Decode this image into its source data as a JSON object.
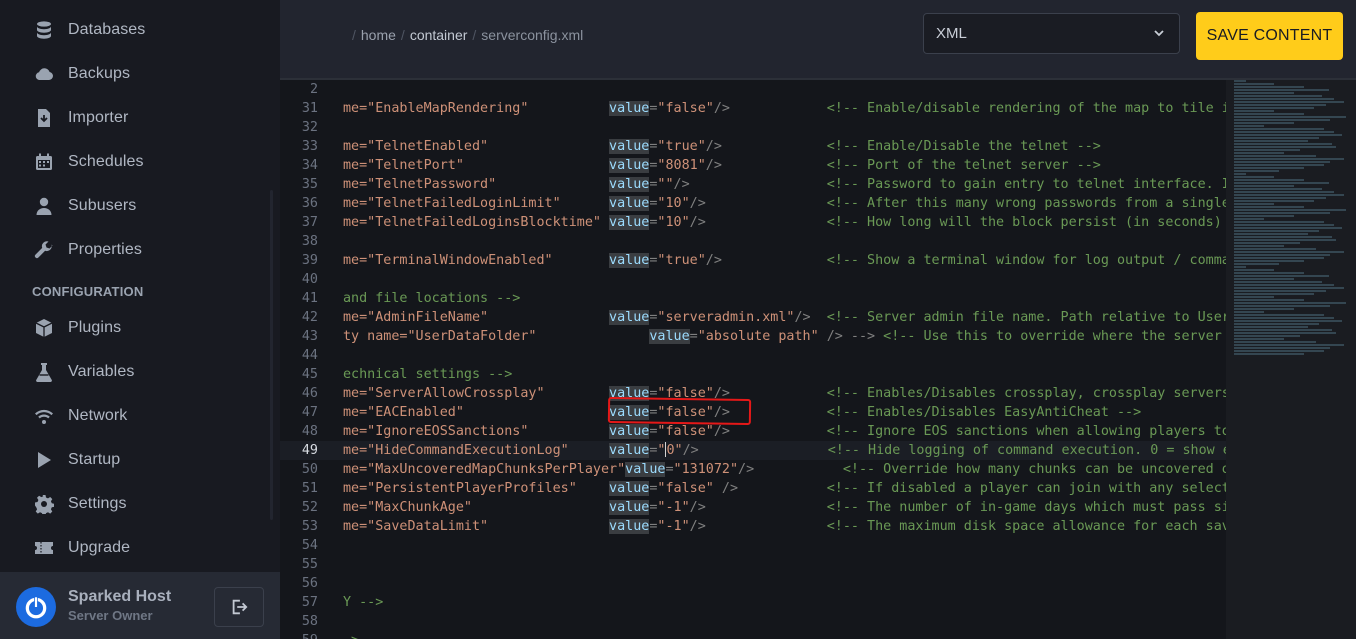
{
  "sidebar": {
    "items": [
      {
        "label": "Databases",
        "icon": "database-icon"
      },
      {
        "label": "Backups",
        "icon": "cloud-icon"
      },
      {
        "label": "Importer",
        "icon": "import-file-icon"
      },
      {
        "label": "Schedules",
        "icon": "calendar-icon"
      },
      {
        "label": "Subusers",
        "icon": "user-icon"
      },
      {
        "label": "Properties",
        "icon": "wrench-icon"
      }
    ],
    "section_configuration": "CONFIGURATION",
    "config_items": [
      {
        "label": "Plugins",
        "icon": "cube-icon"
      },
      {
        "label": "Variables",
        "icon": "flask-icon"
      },
      {
        "label": "Network",
        "icon": "wifi-icon"
      },
      {
        "label": "Startup",
        "icon": "play-icon"
      },
      {
        "label": "Settings",
        "icon": "gear-icon"
      },
      {
        "label": "Upgrade",
        "icon": "ticket-icon"
      }
    ],
    "user": {
      "name": "Sparked Host",
      "role": "Server Owner"
    }
  },
  "header": {
    "breadcrumb": [
      "home",
      "container",
      "serverconfig.xml"
    ],
    "select_value": "XML",
    "save_label": "SAVE CONTENT"
  },
  "editor": {
    "lines": [
      {
        "n": "2",
        "name": "",
        "val": "",
        "comment": "",
        "plain": ""
      },
      {
        "n": "31",
        "name": "me=\"EnableMapRendering\"",
        "val": "\"false\"",
        "close": "/>",
        "comment": "<!-- Enable/disable rendering of the map to tile im"
      },
      {
        "n": "32",
        "plain": ""
      },
      {
        "n": "33",
        "name": "me=\"TelnetEnabled\"",
        "val": "\"true\"",
        "close": "/>",
        "comment": "<!-- Enable/Disable the telnet -->"
      },
      {
        "n": "34",
        "name": "me=\"TelnetPort\"",
        "val": "\"8081\"",
        "close": "/>",
        "comment": "<!-- Port of the telnet server -->"
      },
      {
        "n": "35",
        "name": "me=\"TelnetPassword\"",
        "val": "\"\"",
        "close": "/>",
        "comment": "<!-- Password to gain entry to telnet interface. If"
      },
      {
        "n": "36",
        "name": "me=\"TelnetFailedLoginLimit\"",
        "val": "\"10\"",
        "close": "/>",
        "comment": "<!-- After this many wrong passwords from a single"
      },
      {
        "n": "37",
        "name": "me=\"TelnetFailedLoginsBlocktime\"",
        "val": "\"10\"",
        "close": "/>",
        "comment": "<!-- How long will the block persist (in seconds) -"
      },
      {
        "n": "38",
        "plain": ""
      },
      {
        "n": "39",
        "name": "me=\"TerminalWindowEnabled\"",
        "val": "\"true\"",
        "close": "/>",
        "comment": "<!-- Show a terminal window for log output / comman"
      },
      {
        "n": "40",
        "plain": ""
      },
      {
        "n": "41",
        "plain": "and file locations -->"
      },
      {
        "n": "42",
        "name": "me=\"AdminFileName\"",
        "val": "\"serveradmin.xml\"",
        "close": "/>",
        "comment": "<!-- Server admin file name. Path relative to UserD"
      },
      {
        "n": "43",
        "special": true,
        "name": "ty name=\"UserDataFolder\"",
        "val": "\"absolute path\"",
        "close": " /> -->",
        "comment": "<!-- Use this to override where the server"
      },
      {
        "n": "44",
        "plain": ""
      },
      {
        "n": "45",
        "plain": "echnical settings -->"
      },
      {
        "n": "46",
        "name": "me=\"ServerAllowCrossplay\"",
        "val": "\"false\"",
        "close": "/>",
        "comment": "<!-- Enables/Disables crossplay, crossplay servers"
      },
      {
        "n": "47",
        "name": "me=\"EACEnabled\"",
        "val": "\"false\"",
        "close": "/>",
        "comment": "<!-- Enables/Disables EasyAntiCheat -->"
      },
      {
        "n": "48",
        "name": "me=\"IgnoreEOSSanctions\"",
        "val": "\"false\"",
        "close": "/>",
        "comment": "<!-- Ignore EOS sanctions when allowing players to"
      },
      {
        "n": "49",
        "name": "me=\"HideCommandExecutionLog\"",
        "val": "\"0\"",
        "close": "/>",
        "comment": "<!-- Hide logging of command execution. 0 = show ev",
        "active": true
      },
      {
        "n": "50",
        "name": "me=\"MaxUncoveredMapChunksPerPlayer\"",
        "val": "\"131072\"",
        "close": "/>",
        "comment": "<!-- Override how many chunks can be uncovered on t"
      },
      {
        "n": "51",
        "name": "me=\"PersistentPlayerProfiles\"",
        "val": "\"false\"",
        "close": " />",
        "comment": "<!-- If disabled a player can join with any selecte"
      },
      {
        "n": "52",
        "name": "me=\"MaxChunkAge\"",
        "val": "\"-1\"",
        "close": "/>",
        "comment": "<!-- The number of in-game days which must pass sir"
      },
      {
        "n": "53",
        "name": "me=\"SaveDataLimit\"",
        "val": "\"-1\"",
        "close": "/>",
        "comment": "<!-- The maximum disk space allowance for each save"
      },
      {
        "n": "54",
        "plain": ""
      },
      {
        "n": "55",
        "plain": ""
      },
      {
        "n": "56",
        "plain": ""
      },
      {
        "n": "57",
        "plain": "Y -->"
      },
      {
        "n": "58",
        "plain": ""
      },
      {
        "n": "59",
        "plain": "->"
      }
    ],
    "value_keyword": "value=",
    "accent_color": "#ffcc1a",
    "highlight_color": "#e51818"
  }
}
